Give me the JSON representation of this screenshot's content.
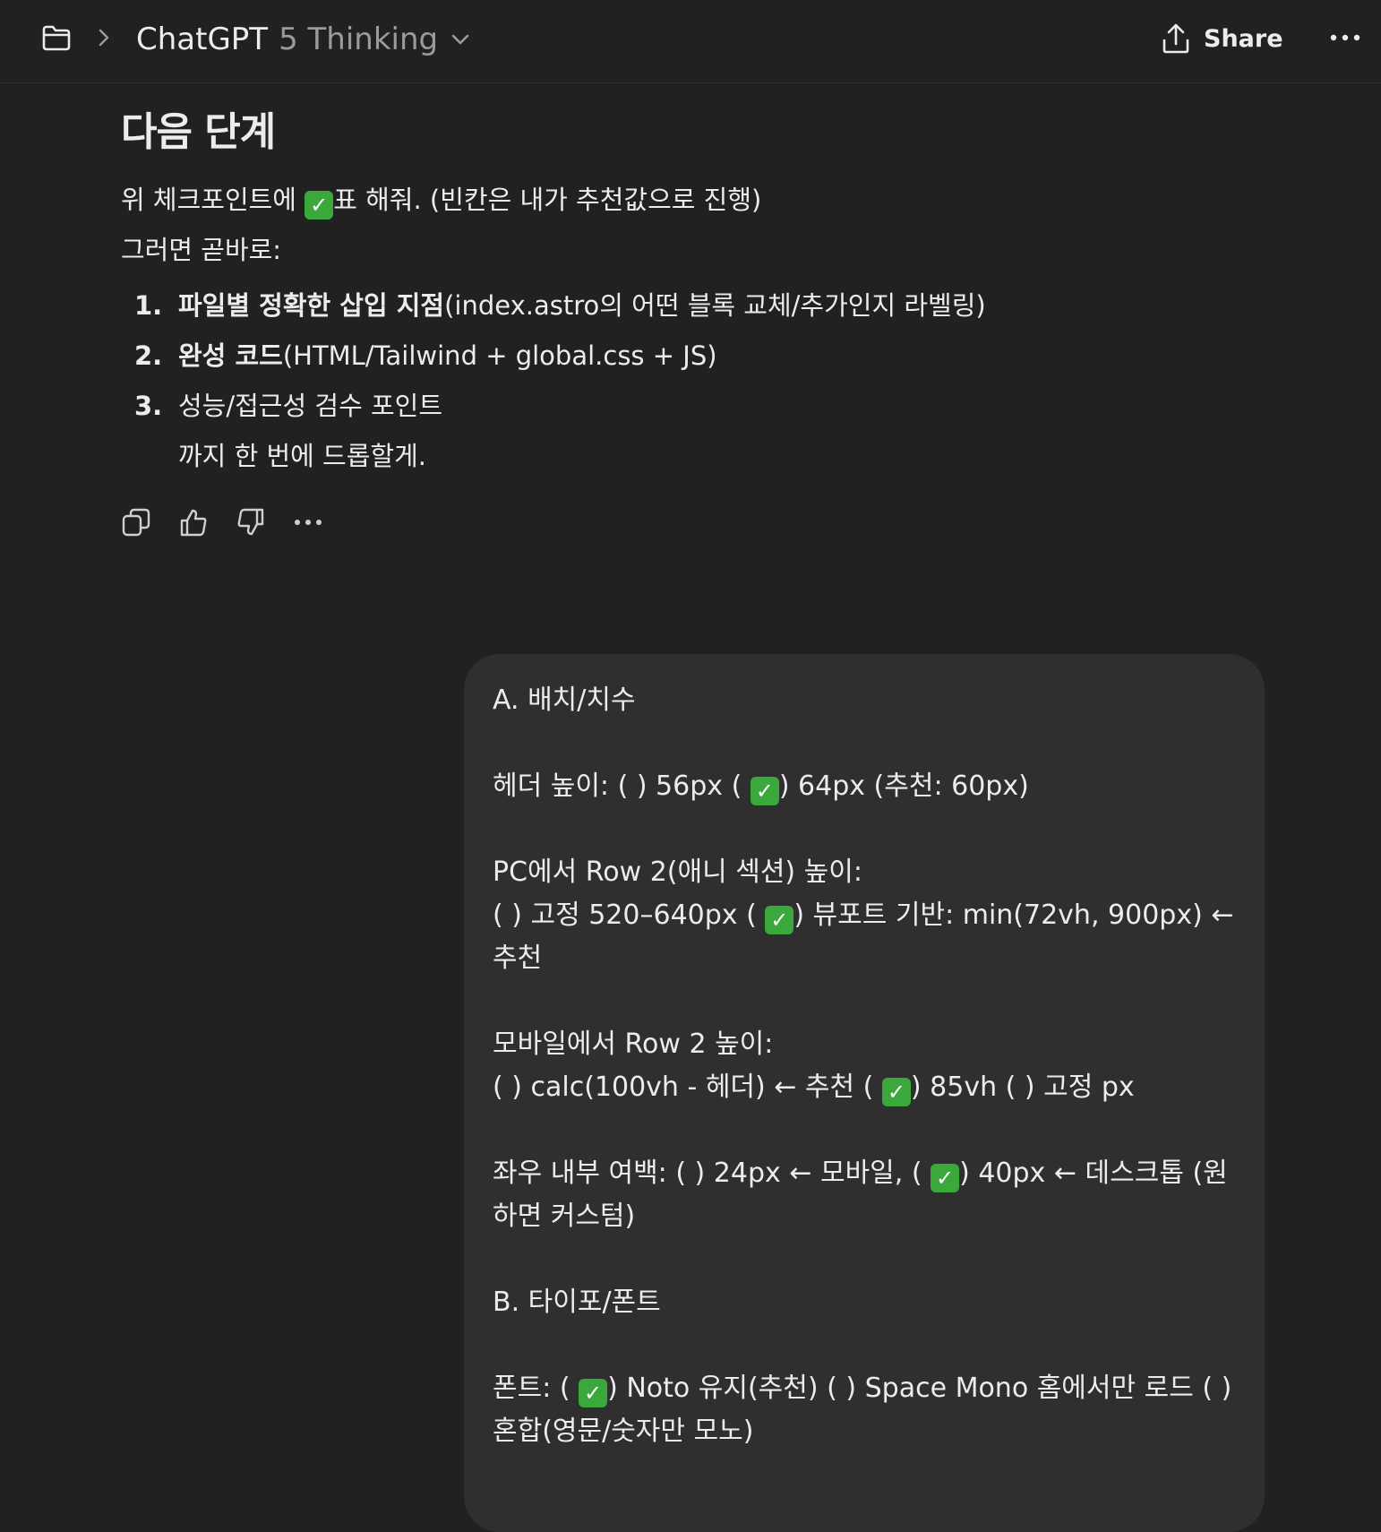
{
  "header": {
    "folder_icon": "folder-icon",
    "separator_icon": "chevron-right-icon",
    "model_name": "ChatGPT",
    "model_version": "5 Thinking",
    "dropdown_icon": "chevron-down-icon",
    "share_label": "Share",
    "share_icon": "share-upload-icon",
    "more_icon": "ellipsis-icon"
  },
  "assistant": {
    "heading": "다음 단계",
    "line1_before": "위 체크포인트에 ",
    "line1_check": "✓",
    "line1_after": "표 해줘. (빈칸은 내가 추천값으로 진행)",
    "line2": "그러면 곧바로:",
    "list": [
      {
        "num": "1.",
        "bold": "파일별 정확한 삽입 지점",
        "rest": "(index.astro의 어떤 블록 교체/추가인지 라벨링)"
      },
      {
        "num": "2.",
        "bold": "완성 코드",
        "rest": "(HTML/Tailwind + global.css + JS)"
      },
      {
        "num": "3.",
        "bold": "",
        "rest": "성능/접근성 검수 포인트"
      }
    ],
    "tail": "까지 한 번에 드롭할게."
  },
  "actions": {
    "copy_icon": "copy-icon",
    "like_icon": "thumbs-up-icon",
    "dislike_icon": "thumbs-down-icon",
    "more_icon": "ellipsis-icon"
  },
  "user_message": {
    "check": "✓",
    "a_title": "A. 배치/치수",
    "header_height_1": "헤더 높이: ( ) 56px ( ",
    "header_height_2": ") 64px (추천: 60px)",
    "pc_row_title": "PC에서 Row 2(애니 섹션) 높이:",
    "pc_row_1": "( ) 고정 520–640px ( ",
    "pc_row_2": ") 뷰포트 기반: min(72vh, 900px) ← 추천",
    "mobile_row_title": "모바일에서 Row 2 높이:",
    "mobile_row_1": "( ) calc(100vh - 헤더) ← 추천 ( ",
    "mobile_row_2": ") 85vh ( ) 고정 px",
    "padding_1": "좌우 내부 여백: ( ) 24px ← 모바일, ( ",
    "padding_2": ") 40px ← 데스크톱 (원하면 커스텀)",
    "b_title": "B. 타이포/폰트",
    "font_1": "폰트: ( ",
    "font_2": ") Noto 유지(추천) ( ) Space Mono 홈에서만 로드 ( ) 혼합(영문/숫자만 모노)"
  }
}
